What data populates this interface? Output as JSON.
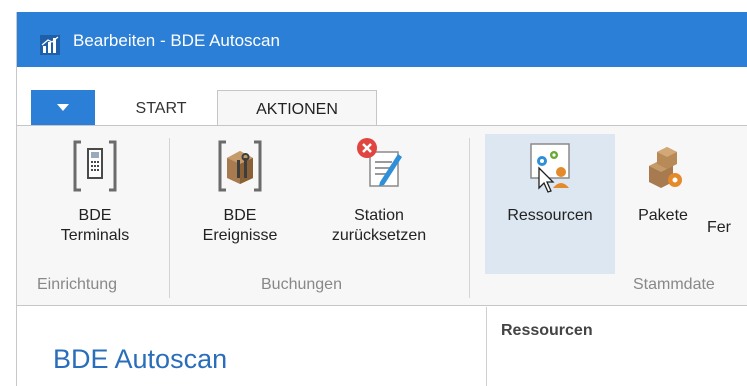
{
  "window": {
    "title": "Bearbeiten - BDE Autoscan",
    "app_icon": "chart-app-icon"
  },
  "tabs": [
    {
      "label": "START",
      "active": false
    },
    {
      "label": "AKTIONEN",
      "active": true
    }
  ],
  "menu_tab_icon": "caret-down-icon",
  "ribbon": {
    "groups": [
      {
        "label": "Einrichtung",
        "buttons": [
          {
            "line1": "BDE",
            "line2": "Terminals",
            "icon": "terminal-icon"
          }
        ]
      },
      {
        "label": "Buchungen",
        "buttons": [
          {
            "line1": "BDE",
            "line2": "Ereignisse",
            "icon": "tools-box-icon"
          },
          {
            "line1": "Station",
            "line2": "zurücksetzen",
            "icon": "reset-station-icon"
          }
        ]
      },
      {
        "label": "Stammdate",
        "buttons": [
          {
            "line1": "Ressourcen",
            "icon": "resources-icon",
            "selected": true
          },
          {
            "line1": "Pakete",
            "icon": "packages-icon"
          },
          {
            "line1": "Fer",
            "icon": ""
          }
        ]
      }
    ]
  },
  "content": {
    "page_title": "BDE Autoscan",
    "panel_title": "Ressourcen"
  },
  "colors": {
    "titlebar": "#2b7fd6",
    "accent_text": "#2a6ebb",
    "selected_button": "#dde7f1",
    "ribbon_bg": "#f7f7f7"
  }
}
